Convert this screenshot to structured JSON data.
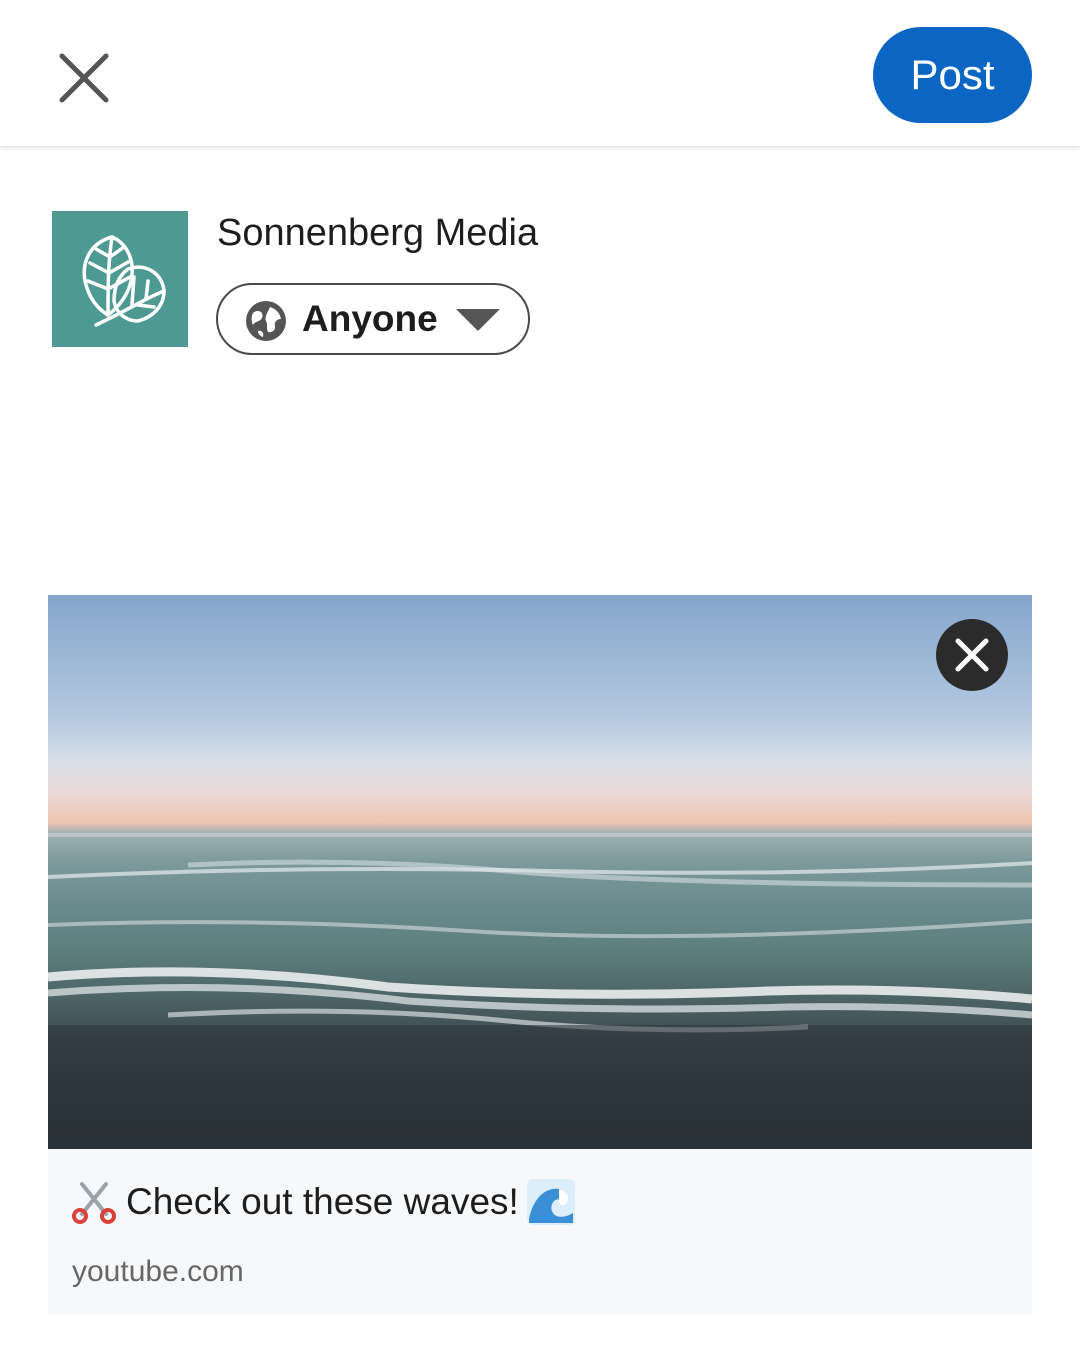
{
  "header": {
    "close_icon": "close-icon",
    "post_label": "Post",
    "post_color": "#0a66c2"
  },
  "author": {
    "name": "Sonnenberg Media",
    "avatar_icon": "leaf-logo-icon",
    "avatar_color": "#4e9a93"
  },
  "visibility": {
    "icon": "globe-icon",
    "selected": "Anyone",
    "dropdown_icon": "caret-down-icon"
  },
  "link_preview": {
    "image": "ocean waves at sunset",
    "remove_icon": "close-circle-icon",
    "title_prefix_emoji": "scissors-icon",
    "title": "Check out these waves!",
    "title_suffix_emoji": "wave-icon",
    "domain": "youtube.com"
  }
}
